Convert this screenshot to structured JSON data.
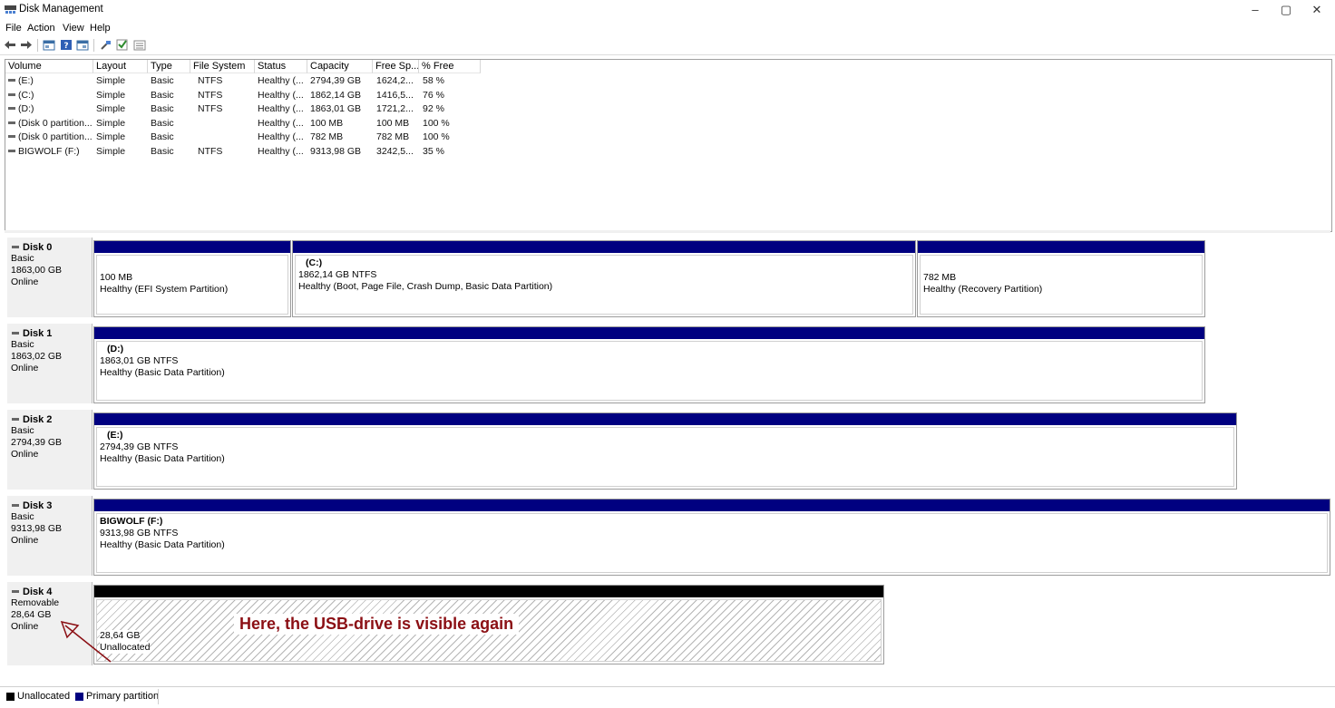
{
  "window": {
    "title": "Disk Management",
    "controls": {
      "minimize": "–",
      "maximize": "▢",
      "close": "✕"
    }
  },
  "menu": [
    "File",
    "Action",
    "View",
    "Help"
  ],
  "toolbar": [
    "back-icon",
    "forward-icon",
    "properties-icon",
    "help-icon",
    "console-icon",
    "connect-icon",
    "check-icon",
    "list-icon"
  ],
  "volume_list": {
    "columns": [
      "Volume",
      "Layout",
      "Type",
      "File System",
      "Status",
      "Capacity",
      "Free Sp...",
      "% Free"
    ],
    "rows": [
      [
        "(E:)",
        "Simple",
        "Basic",
        "NTFS",
        "Healthy (...",
        "2794,39 GB",
        "1624,2...",
        "58 %"
      ],
      [
        "(C:)",
        "Simple",
        "Basic",
        "NTFS",
        "Healthy (...",
        "1862,14 GB",
        "1416,5...",
        "76 %"
      ],
      [
        "(D:)",
        "Simple",
        "Basic",
        "NTFS",
        "Healthy (...",
        "1863,01 GB",
        "1721,2...",
        "92 %"
      ],
      [
        "(Disk 0 partition...",
        "Simple",
        "Basic",
        "",
        "Healthy (...",
        "100 MB",
        "100 MB",
        "100 %"
      ],
      [
        "(Disk 0 partition...",
        "Simple",
        "Basic",
        "",
        "Healthy (...",
        "782 MB",
        "782 MB",
        "100 %"
      ],
      [
        "BIGWOLF (F:)",
        "Simple",
        "Basic",
        "NTFS",
        "Healthy (...",
        "9313,98 GB",
        "3242,5...",
        "35 %"
      ]
    ]
  },
  "disks": [
    {
      "name": "Disk 0",
      "type": "Basic",
      "size": "1863,00 GB",
      "status": "Online",
      "partitions": [
        {
          "name": "",
          "size": "100 MB",
          "status": "Healthy (EFI System Partition)"
        },
        {
          "name": "(C:)",
          "size": "1862,14 GB NTFS",
          "status": "Healthy (Boot, Page File, Crash Dump, Basic Data Partition)"
        },
        {
          "name": "",
          "size": "782 MB",
          "status": "Healthy (Recovery Partition)"
        }
      ]
    },
    {
      "name": "Disk 1",
      "type": "Basic",
      "size": "1863,02 GB",
      "status": "Online",
      "partitions": [
        {
          "name": "(D:)",
          "size": "1863,01 GB NTFS",
          "status": "Healthy (Basic Data Partition)"
        }
      ]
    },
    {
      "name": "Disk 2",
      "type": "Basic",
      "size": "2794,39 GB",
      "status": "Online",
      "partitions": [
        {
          "name": "(E:)",
          "size": "2794,39 GB NTFS",
          "status": "Healthy (Basic Data Partition)"
        }
      ]
    },
    {
      "name": "Disk 3",
      "type": "Basic",
      "size": "9313,98 GB",
      "status": "Online",
      "partitions": [
        {
          "name": "BIGWOLF  (F:)",
          "size": "9313,98 GB NTFS",
          "status": "Healthy (Basic Data Partition)"
        }
      ]
    },
    {
      "name": "Disk 4",
      "type": "Removable",
      "size": "28,64 GB",
      "status": "Online",
      "partitions": [
        {
          "name": "",
          "size": "28,64 GB",
          "status": "Unallocated"
        }
      ]
    }
  ],
  "annotation": "Here, the USB-drive is visible again",
  "legend": {
    "unallocated": {
      "label": "Unallocated",
      "color": "#000000"
    },
    "primary": {
      "label": "Primary partition",
      "color": "#000080"
    }
  },
  "colors": {
    "primary_bar": "#000080",
    "annotation": "#8b0f14"
  }
}
